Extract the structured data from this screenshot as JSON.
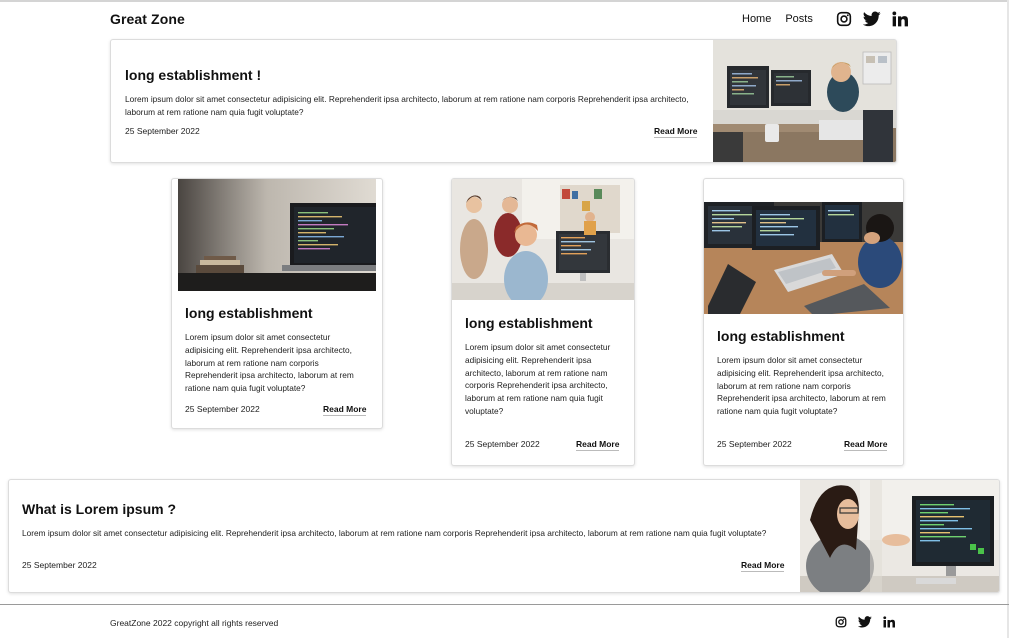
{
  "header": {
    "brand": "Great Zone",
    "nav": [
      {
        "label": "Home"
      },
      {
        "label": "Posts"
      }
    ],
    "social_icons": [
      "instagram-icon",
      "twitter-icon",
      "linkedin-icon"
    ]
  },
  "featured": {
    "title": "long establishment !",
    "body": "Lorem ipsum dolor sit amet consectetur adipisicing elit. Reprehenderit ipsa architecto, laborum at rem ratione nam corporis Reprehenderit ipsa architecto, laborum at rem ratione nam quia fugit voluptate?",
    "date": "25 September 2022",
    "read_more": "Read More"
  },
  "cards": [
    {
      "title": "long establishment",
      "body": "Lorem ipsum dolor sit amet consectetur adipisicing elit. Reprehenderit ipsa architecto, laborum at rem ratione nam corporis Reprehenderit ipsa architecto, laborum at rem ratione nam quia fugit voluptate?",
      "date": "25 September 2022",
      "read_more": "Read More"
    },
    {
      "title": "long establishment",
      "body": "Lorem ipsum dolor sit amet consectetur adipisicing elit. Reprehenderit ipsa architecto, laborum at rem ratione nam corporis Reprehenderit ipsa architecto, laborum at rem ratione nam quia fugit voluptate?",
      "date": "25 September 2022",
      "read_more": "Read More"
    },
    {
      "title": "long establishment",
      "body": "Lorem ipsum dolor sit amet consectetur adipisicing elit. Reprehenderit ipsa architecto, laborum at rem ratione nam corporis Reprehenderit ipsa architecto, laborum at rem ratione nam quia fugit voluptate?",
      "date": "25 September 2022",
      "read_more": "Read More"
    }
  ],
  "bottom": {
    "title": "What is Lorem ipsum ?",
    "body": "Lorem ipsum dolor sit amet consectetur adipisicing elit. Reprehenderit ipsa architecto, laborum at rem ratione nam corporis Reprehenderit ipsa architecto, laborum at rem ratione nam quia fugit voluptate?",
    "date": "25 September 2022",
    "read_more": "Read More"
  },
  "footer": {
    "copyright": "GreatZone 2022 copyright all rights reserved",
    "social_icons": [
      "instagram-icon",
      "twitter-icon",
      "linkedin-icon"
    ]
  }
}
